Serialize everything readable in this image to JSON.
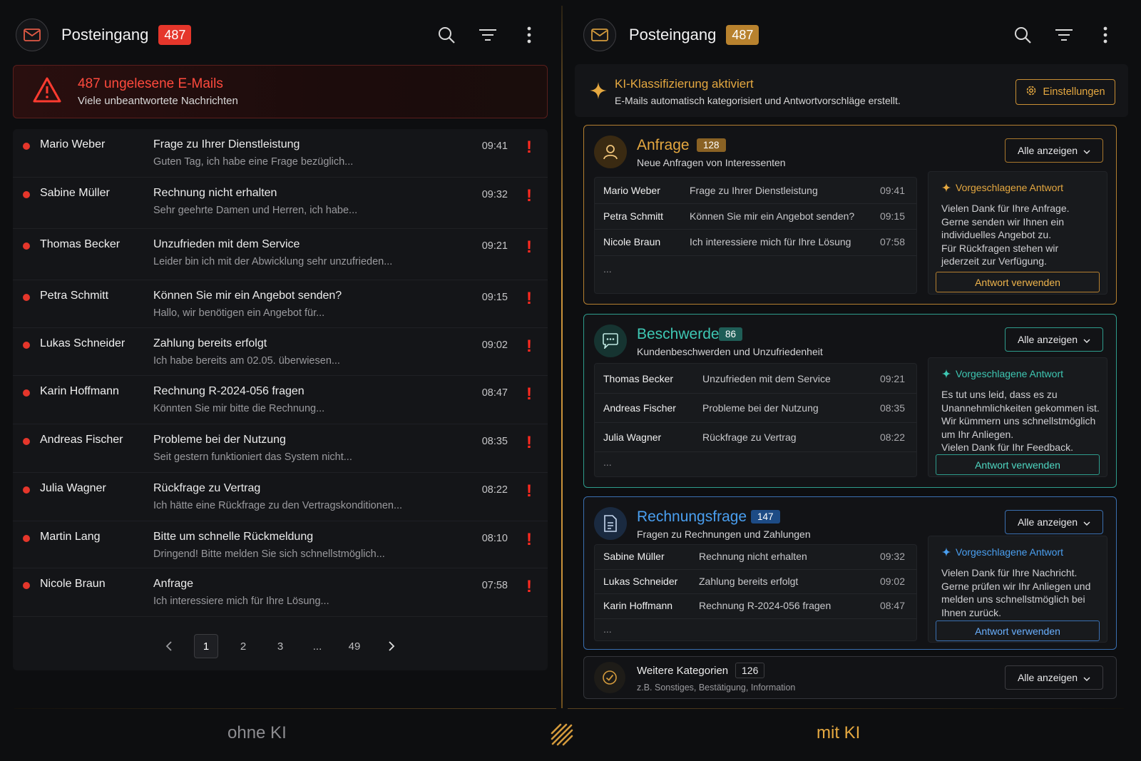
{
  "left": {
    "title": "Posteingang",
    "count": "487",
    "alert": {
      "title": "487 ungelesene E-Mails",
      "subtitle": "Viele unbeantwortete Nachrichten"
    },
    "mails": [
      {
        "from": "Mario Weber",
        "subject": "Frage zu Ihrer Dienstleistung",
        "preview": "Guten Tag, ich habe eine Frage bezüglich...",
        "time": "09:41"
      },
      {
        "from": "Sabine Müller",
        "subject": "Rechnung nicht erhalten",
        "preview": "Sehr geehrte Damen und Herren, ich habe...",
        "time": "09:32"
      },
      {
        "from": "Thomas Becker",
        "subject": "Unzufrieden mit dem Service",
        "preview": "Leider bin ich mit der Abwicklung sehr unzufrieden...",
        "time": "09:21"
      },
      {
        "from": "Petra Schmitt",
        "subject": "Können Sie mir ein Angebot senden?",
        "preview": "Hallo, wir benötigen ein Angebot für...",
        "time": "09:15"
      },
      {
        "from": "Lukas Schneider",
        "subject": "Zahlung bereits erfolgt",
        "preview": "Ich habe bereits am 02.05. überwiesen...",
        "time": "09:02"
      },
      {
        "from": "Karin Hoffmann",
        "subject": "Rechnung R-2024-056 fragen",
        "preview": "Könnten Sie mir bitte die Rechnung...",
        "time": "08:47"
      },
      {
        "from": "Andreas Fischer",
        "subject": "Probleme bei der Nutzung",
        "preview": "Seit gestern funktioniert das System nicht...",
        "time": "08:35"
      },
      {
        "from": "Julia Wagner",
        "subject": "Rückfrage zu Vertrag",
        "preview": "Ich hätte eine Rückfrage zu den Vertragskonditionen...",
        "time": "08:22"
      },
      {
        "from": "Martin Lang",
        "subject": "Bitte um schnelle Rückmeldung",
        "preview": "Dringend! Bitte melden Sie sich schnellstmöglich...",
        "time": "08:10"
      },
      {
        "from": "Nicole Braun",
        "subject": "Anfrage",
        "preview": "Ich interessiere mich für Ihre Lösung...",
        "time": "07:58"
      }
    ],
    "urgent_mark": "!",
    "pagination": {
      "pages": [
        "1",
        "2",
        "3",
        "...",
        "49"
      ],
      "current": "1"
    },
    "footer": "ohne KI"
  },
  "right": {
    "title": "Posteingang",
    "count": "487",
    "ki_banner": {
      "title": "KI-Klassifizierung aktiviert",
      "subtitle": "E-Mails automatisch kategorisiert und Antwortvorschläge erstellt.",
      "settings_label": "Einstellungen"
    },
    "categories": [
      {
        "title": "Anfrage",
        "count": "128",
        "subtitle": "Neue Anfragen von Interessenten",
        "show_all": "Alle anzeigen",
        "accent": "#d39a3c",
        "mails": [
          {
            "from": "Mario Weber",
            "subject": "Frage zu Ihrer Dienstleistung",
            "time": "09:41"
          },
          {
            "from": "Petra Schmitt",
            "subject": "Können Sie mir ein Angebot senden?",
            "time": "09:15"
          },
          {
            "from": "Nicole Braun",
            "subject": "Ich interessiere mich für Ihre Lösung",
            "time": "07:58"
          }
        ],
        "more": "...",
        "suggestion_title": "Vorgeschlagene Antwort",
        "suggestion_text": "Vielen Dank für Ihre Anfrage.\nGerne senden wir Ihnen ein\nindividuelles Angebot zu.\nFür Rückfragen stehen wir\njederzeit zur Verfügung.",
        "use_label": "Antwort verwenden"
      },
      {
        "title": "Beschwerde",
        "count": "86",
        "subtitle": "Kundenbeschwerden und Unzufriedenheit",
        "show_all": "Alle anzeigen",
        "accent": "#3ec7b3",
        "mails": [
          {
            "from": "Thomas Becker",
            "subject": "Unzufrieden mit dem Service",
            "time": "09:21"
          },
          {
            "from": "Andreas Fischer",
            "subject": "Probleme bei der Nutzung",
            "time": "08:35"
          },
          {
            "from": "Julia Wagner",
            "subject": "Rückfrage zu Vertrag",
            "time": "08:22"
          }
        ],
        "more": "...",
        "suggestion_title": "Vorgeschlagene Antwort",
        "suggestion_text": "Es tut uns leid, dass es zu\nUnannehmlichkeiten gekommen ist.\nWir kümmern uns schnellstmöglich\num Ihr Anliegen.\nVielen Dank für Ihr Feedback.",
        "use_label": "Antwort verwenden"
      },
      {
        "title": "Rechnungsfrage",
        "count": "147",
        "subtitle": "Fragen zu Rechnungen und Zahlungen",
        "show_all": "Alle anzeigen",
        "accent": "#4a8fe0",
        "mails": [
          {
            "from": "Sabine Müller",
            "subject": "Rechnung nicht erhalten",
            "time": "09:32"
          },
          {
            "from": "Lukas Schneider",
            "subject": "Zahlung bereits erfolgt",
            "time": "09:02"
          },
          {
            "from": "Karin Hoffmann",
            "subject": "Rechnung R-2024-056 fragen",
            "time": "08:47"
          }
        ],
        "more": "...",
        "suggestion_title": "Vorgeschlagene Antwort",
        "suggestion_text": "Vielen Dank für Ihre Nachricht.\nGerne prüfen wir Ihr Anliegen und\nmelden uns schnellstmöglich bei\nIhnen zurück.",
        "use_label": "Antwort verwenden"
      }
    ],
    "further": {
      "title": "Weitere Kategorien",
      "count": "126",
      "subtitle": "z.B. Sonstiges, Bestätigung, Information",
      "show_all": "Alle anzeigen"
    },
    "footer": "mit KI"
  },
  "colors": {
    "danger": "#e5362b",
    "gold": "#d39a3c",
    "teal": "#3ec7b3",
    "blue": "#4a8fe0"
  }
}
